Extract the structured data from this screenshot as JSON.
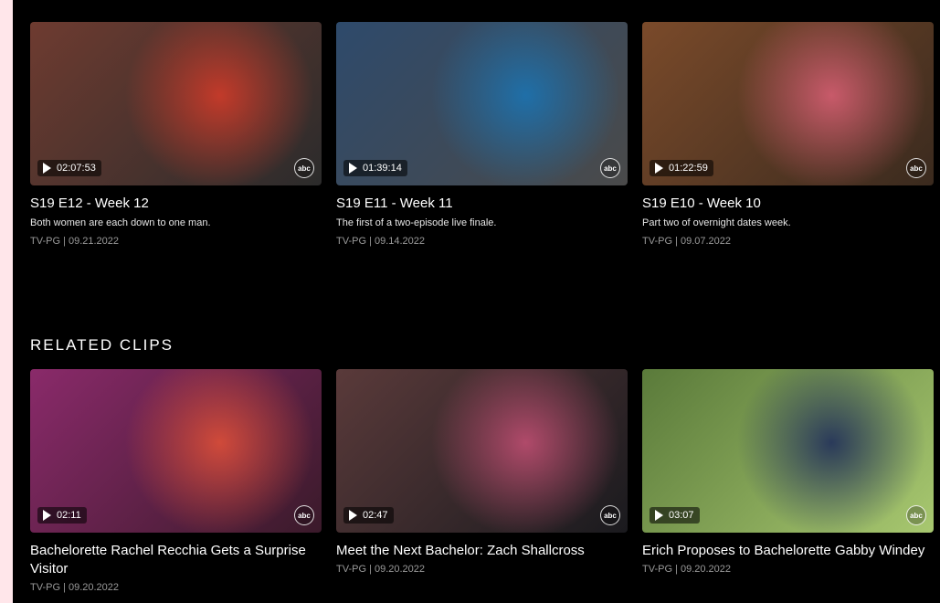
{
  "episodes": [
    {
      "duration": "02:07:53",
      "title": "S19 E12 - Week 12",
      "description": "Both women are each down to one man.",
      "meta": "TV-PG | 09.21.2022",
      "network": "abc",
      "colors": [
        "#6e3b30",
        "#2b2b2b",
        "#c23a2a"
      ]
    },
    {
      "duration": "01:39:14",
      "title": "S19 E11 - Week 11",
      "description": "The first of a two-episode live finale.",
      "meta": "TV-PG | 09.14.2022",
      "network": "abc",
      "colors": [
        "#2e4a6b",
        "#4a4a4a",
        "#1f6fa8"
      ]
    },
    {
      "duration": "01:22:59",
      "title": "S19 E10 - Week 10",
      "description": "Part two of overnight dates week.",
      "meta": "TV-PG | 09.07.2022",
      "network": "abc",
      "colors": [
        "#7a4a2a",
        "#3a2a1e",
        "#c85a6a"
      ]
    }
  ],
  "related": {
    "heading": "RELATED CLIPS",
    "clips": [
      {
        "duration": "02:11",
        "title": "Bachelorette Rachel Recchia Gets a Surprise Visitor",
        "meta": "TV-PG | 09.20.2022",
        "network": "abc",
        "colors": [
          "#8a2a6a",
          "#3a1a2a",
          "#d04a3a"
        ]
      },
      {
        "duration": "02:47",
        "title": "Meet the Next Bachelor: Zach Shallcross",
        "meta": "TV-PG | 09.20.2022",
        "network": "abc",
        "colors": [
          "#5a3a3a",
          "#1a1a1e",
          "#b04a6a"
        ]
      },
      {
        "duration": "03:07",
        "title": "Erich Proposes to Bachelorette Gabby Windey",
        "meta": "TV-PG | 09.20.2022",
        "network": "abc",
        "colors": [
          "#5a7a3a",
          "#a8c870",
          "#2a3a5a"
        ]
      }
    ]
  }
}
